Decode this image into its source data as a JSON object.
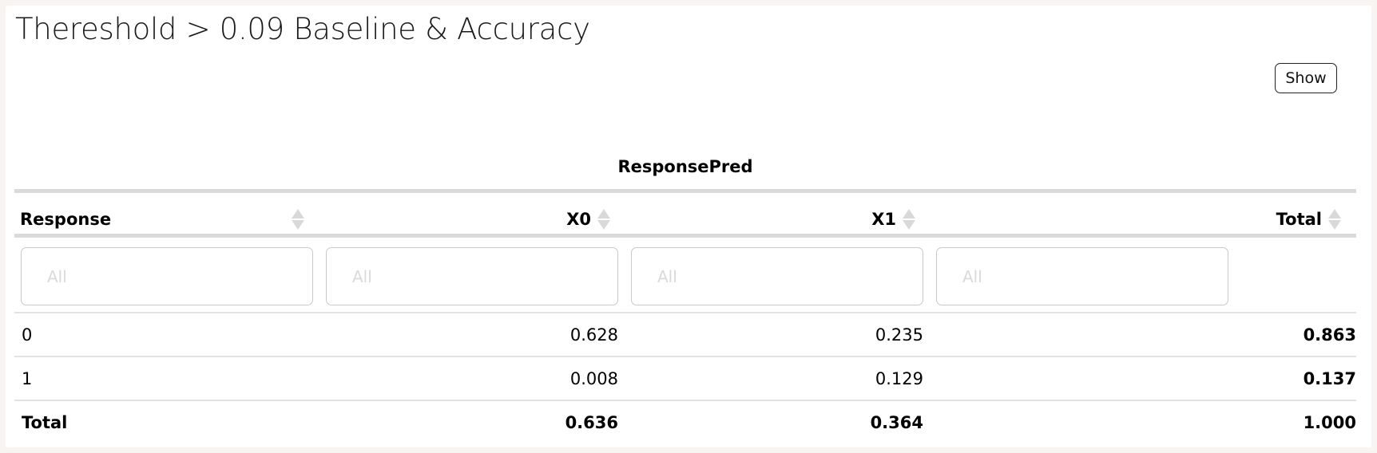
{
  "title": "Thereshold > 0.09 Baseline & Accuracy",
  "show_button": "Show",
  "table": {
    "group_header": "ResponsePred",
    "columns": [
      {
        "label": "Response",
        "align": "left"
      },
      {
        "label": "X0",
        "align": "right"
      },
      {
        "label": "X1",
        "align": "right"
      },
      {
        "label": "Total",
        "align": "right"
      }
    ],
    "filter_placeholder": "All",
    "rows": [
      {
        "cells": [
          "0",
          "0.628",
          "0.235",
          "0.863"
        ]
      },
      {
        "cells": [
          "1",
          "0.008",
          "0.129",
          "0.137"
        ]
      },
      {
        "cells": [
          "Total",
          "0.636",
          "0.364",
          "1.000"
        ]
      }
    ]
  },
  "colors": {
    "page_background": "#f7f4f1",
    "panel_background": "#ffffff",
    "rule": "#dadada",
    "sort_icon": "#d9d9d9",
    "placeholder": "#dadada"
  }
}
